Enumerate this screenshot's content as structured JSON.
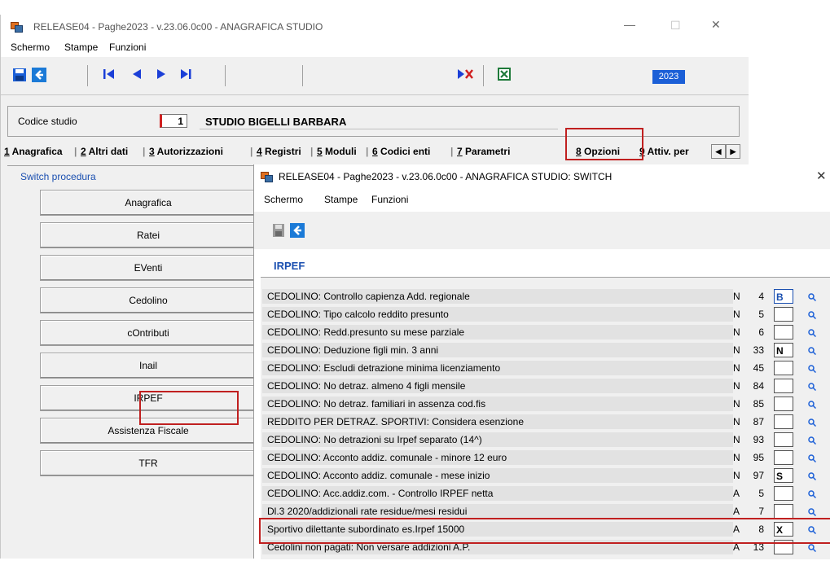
{
  "main_window": {
    "title": "RELEASE04 - Paghe2023 - v.23.06.0c00 - ANAGRAFICA STUDIO",
    "menu": [
      "Schermo",
      "Stampe",
      "Funzioni"
    ],
    "year_badge": "2023",
    "codice_studio_label": "Codice studio",
    "codice_studio_value": "1",
    "studio_name": "STUDIO BIGELLI BARBARA",
    "tabs": [
      {
        "num": "1",
        "label": "Anagrafica"
      },
      {
        "num": "2",
        "label": "Altri dati"
      },
      {
        "num": "3",
        "label": "Autorizzazioni"
      },
      {
        "num": "4",
        "label": "Registri"
      },
      {
        "num": "5",
        "label": "Moduli"
      },
      {
        "num": "6",
        "label": "Codici enti"
      },
      {
        "num": "7",
        "label": "Parametri"
      },
      {
        "num": "8",
        "label": "Opzioni"
      },
      {
        "num": "9",
        "label": "Attiv. per"
      }
    ],
    "switch_label": "Switch procedura",
    "procedure_buttons": [
      "Anagrafica",
      "Ratei",
      "EVenti",
      "Cedolino",
      "cOntributi",
      "Inail",
      "IRPEF",
      "Assistenza Fiscale",
      "TFR"
    ]
  },
  "switch_window": {
    "title": "RELEASE04 - Paghe2023 - v.23.06.0c00 - ANAGRAFICA STUDIO: SWITCH",
    "menu": [
      "Schermo",
      "Stampe",
      "Funzioni"
    ],
    "section_title": "IRPEF",
    "rows": [
      {
        "desc": "CEDOLINO: Controllo capienza Add. regionale",
        "flag": "N",
        "num": "4",
        "value": "B"
      },
      {
        "desc": "CEDOLINO: Tipo calcolo reddito presunto",
        "flag": "N",
        "num": "5",
        "value": ""
      },
      {
        "desc": "CEDOLINO: Redd.presunto su mese parziale",
        "flag": "N",
        "num": "6",
        "value": ""
      },
      {
        "desc": "CEDOLINO: Deduzione figli min. 3 anni",
        "flag": "N",
        "num": "33",
        "value": "N"
      },
      {
        "desc": "CEDOLINO: Escludi detrazione minima licenziamento",
        "flag": "N",
        "num": "45",
        "value": ""
      },
      {
        "desc": "CEDOLINO: No detraz. almeno 4 figli mensile",
        "flag": "N",
        "num": "84",
        "value": ""
      },
      {
        "desc": "CEDOLINO: No detraz. familiari in assenza cod.fis",
        "flag": "N",
        "num": "85",
        "value": ""
      },
      {
        "desc": "REDDITO PER DETRAZ. SPORTIVI: Considera esenzione",
        "flag": "N",
        "num": "87",
        "value": ""
      },
      {
        "desc": "CEDOLINO: No detrazioni su Irpef separato (14^)",
        "flag": "N",
        "num": "93",
        "value": ""
      },
      {
        "desc": "CEDOLINO: Acconto addiz. comunale - minore 12 euro",
        "flag": "N",
        "num": "95",
        "value": ""
      },
      {
        "desc": "CEDOLINO: Acconto addiz. comunale - mese inizio",
        "flag": "N",
        "num": "97",
        "value": "S"
      },
      {
        "desc": "CEDOLINO: Acc.addiz.com. - Controllo IRPEF netta",
        "flag": "A",
        "num": "5",
        "value": ""
      },
      {
        "desc": "Dl.3 2020/addizionali rate residue/mesi residui",
        "flag": "A",
        "num": "7",
        "value": ""
      },
      {
        "desc": "Sportivo dilettante subordinato es.Irpef 15000",
        "flag": "A",
        "num": "8",
        "value": "X"
      },
      {
        "desc": "Cedolini non pagati: Non versare addizioni A.P.",
        "flag": "A",
        "num": "13",
        "value": ""
      }
    ]
  },
  "icons": {
    "save": "save-icon",
    "back": "back-arrow-icon",
    "first": "first-record-icon",
    "prev": "previous-record-icon",
    "next": "next-record-icon",
    "last": "last-record-icon",
    "delete": "delete-icon",
    "excel": "excel-icon",
    "search": "magnifier-icon"
  },
  "colors": {
    "accent": "#1b5fd7",
    "highlight": "#c02020",
    "label_blue": "#1a4fb0"
  }
}
